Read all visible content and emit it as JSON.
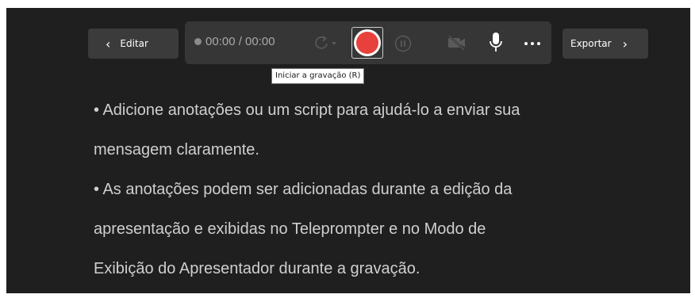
{
  "toolbar": {
    "edit_label": "Editar",
    "export_label": "Exportar",
    "timer": "00:00 / 00:00",
    "tooltip": "Iniciar a gravação (R)"
  },
  "icons": {
    "back": "chevron-left-icon",
    "forward": "chevron-right-icon",
    "restart": "restart-icon",
    "record": "record-icon",
    "pause": "pause-icon",
    "camera": "camera-off-icon",
    "mic": "microphone-icon",
    "more": "more-options-icon"
  },
  "colors": {
    "background": "#1f1f1f",
    "bar": "#363636",
    "button": "#3b3b3b",
    "record": "#e8403a",
    "text": "#cfcfcf"
  },
  "notes": {
    "line1": "• Adicione anotações ou um script para ajudá-lo a enviar sua",
    "line2": "mensagem claramente.",
    "line3": "• As anotações podem ser adicionadas durante a edição da",
    "line4": "apresentação e exibidas no Teleprompter e no Modo de",
    "line5": "Exibição do Apresentador durante a gravação."
  }
}
